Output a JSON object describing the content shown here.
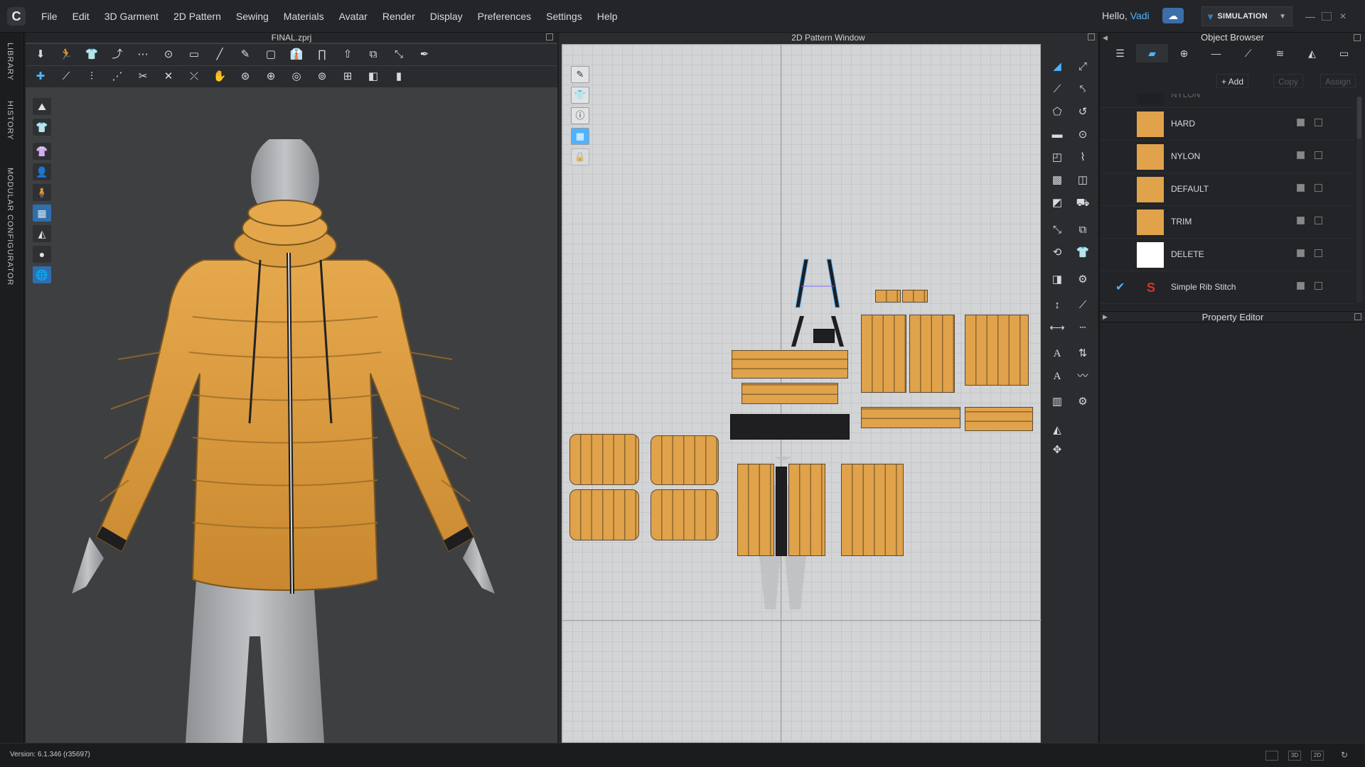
{
  "menubar": {
    "logo_glyph": "C",
    "items": [
      "File",
      "Edit",
      "3D Garment",
      "2D Pattern",
      "Sewing",
      "Materials",
      "Avatar",
      "Render",
      "Display",
      "Preferences",
      "Settings",
      "Help"
    ],
    "greeting_prefix": "Hello,",
    "user_name": "Vadi",
    "mode_label": "SIMULATION"
  },
  "left_tabs": [
    "LIBRARY",
    "HISTORY",
    "MODULAR CONFIGURATOR"
  ],
  "window_3d": {
    "title": "FINAL.zprj"
  },
  "window_2d": {
    "title": "2D Pattern Window"
  },
  "object_browser": {
    "title": "Object Browser",
    "add_label": "+ Add",
    "copy_label": "Copy",
    "assign_label": "Assign",
    "materials": [
      {
        "name": "NYLON",
        "color": "#1f2023",
        "partial": true
      },
      {
        "name": "HARD",
        "color": "#e0a24a"
      },
      {
        "name": "NYLON",
        "color": "#e0a24a"
      },
      {
        "name": "DEFAULT",
        "color": "#e0a24a"
      },
      {
        "name": "TRIM",
        "color": "#e0a24a"
      },
      {
        "name": "DELETE",
        "color": "#ffffff"
      },
      {
        "name": "Simple Rib Stitch",
        "color": "#d93030",
        "checked": true
      }
    ]
  },
  "property_editor": {
    "title": "Property Editor"
  },
  "status": {
    "version": "Version: 6.1.346 (r35697)"
  },
  "colors": {
    "accent": "#4fb3ff",
    "fabric": "#e0a24a",
    "ui_bg": "#232427"
  }
}
